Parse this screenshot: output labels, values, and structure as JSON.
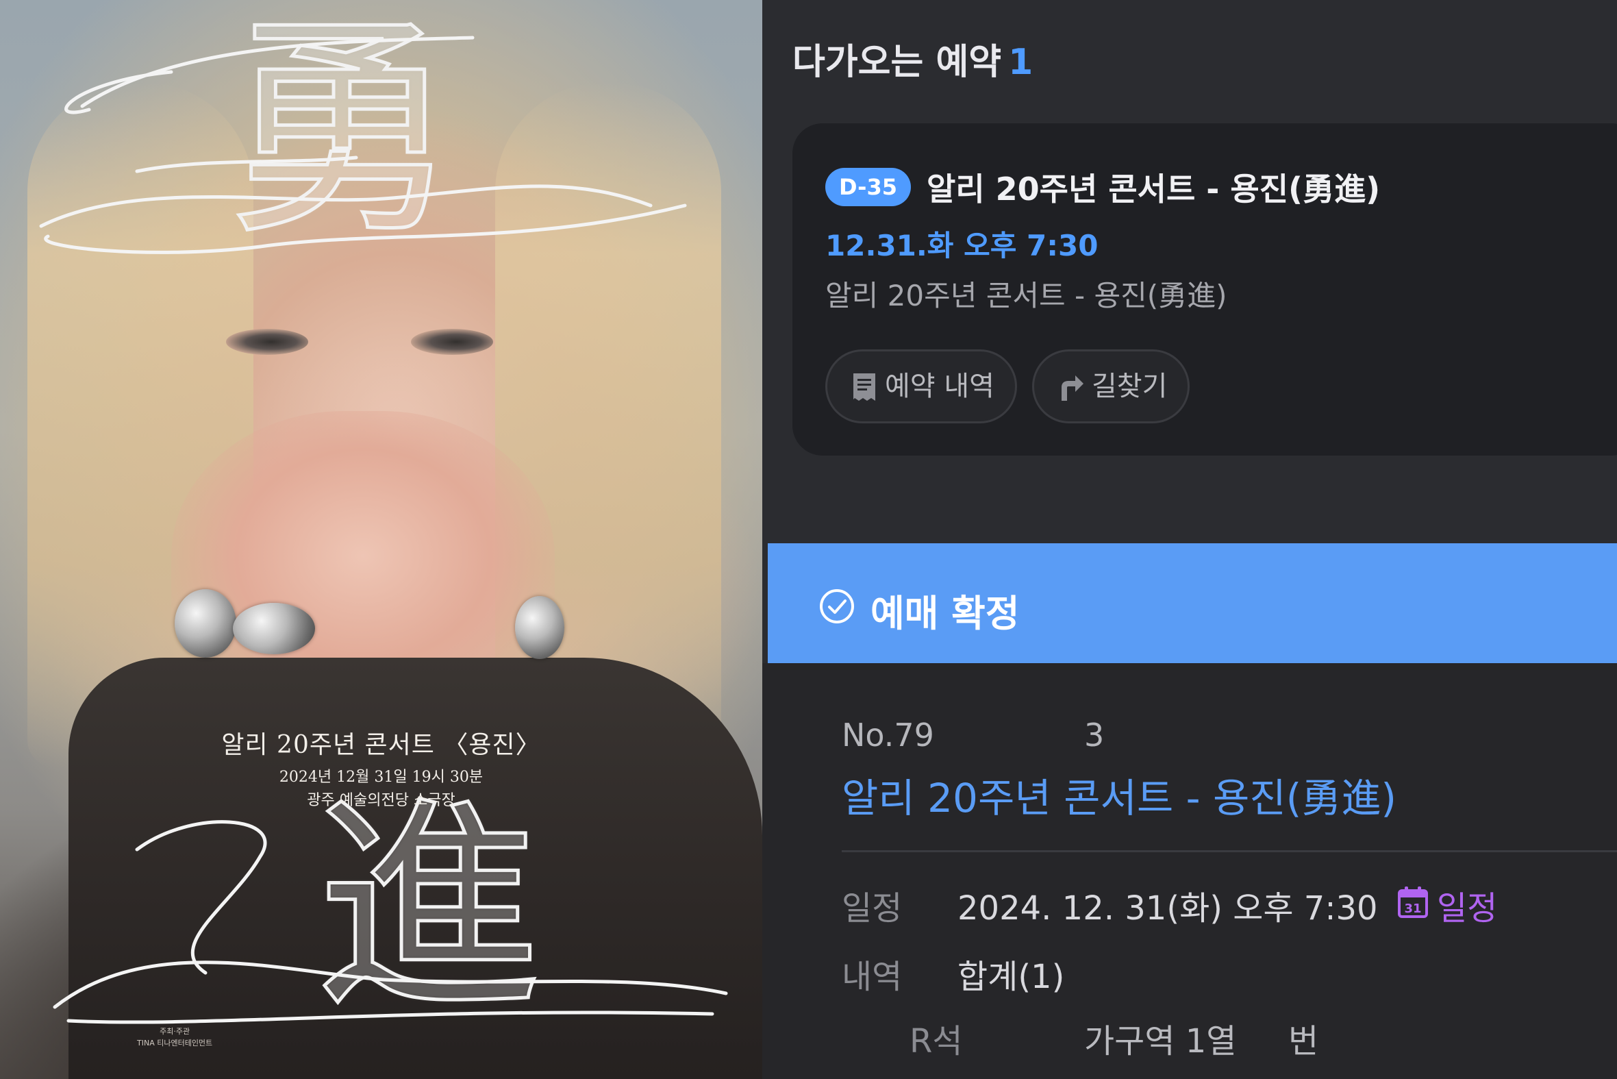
{
  "poster": {
    "title": "알리 20주년 콘서트 〈용진〉",
    "datetime": "2024년 12월 31일 19시 30분",
    "venue": "광주 예술의전당 소극장",
    "calligraphy_top": "勇",
    "calligraphy_bottom": "進",
    "credit_line1": "주최·주관",
    "credit_line2": "TINA 티나엔터테인먼트"
  },
  "upcoming": {
    "label": "다가오는 예약",
    "count": "1"
  },
  "reservation_card": {
    "dday": "D-35",
    "title": "알리 20주년 콘서트 - 용진(勇進)",
    "time": "12.31.화 오후 7:30",
    "subtitle": "알리 20주년 콘서트 - 용진(勇進)",
    "receipt_button": "예약 내역",
    "route_button": "길찾기"
  },
  "confirmation": {
    "status": "예매 확정",
    "booking_no": "No.79",
    "quantity": "3",
    "title": "알리 20주년 콘서트 - 용진(勇進)",
    "schedule_label": "일정",
    "schedule_value": "2024. 12. 31(화) 오후 7:30",
    "calendar_icon_day": "31",
    "calendar_link": "일정",
    "details_label": "내역",
    "details_value": "합계(1)",
    "seat_grade": "R석",
    "seat_location": "가구역 1열",
    "seat_number": "번"
  },
  "colors": {
    "accent_blue": "#4f9bff",
    "confirm_bar": "#5a9cf5",
    "calendar_purple": "#b064f0",
    "panel_bg": "#2b2c30",
    "card_bg": "#1f2024"
  }
}
